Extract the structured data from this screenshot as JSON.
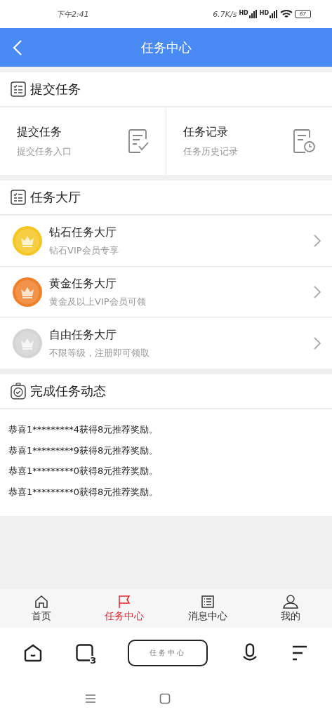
{
  "status_bar": {
    "time": "下午2:41",
    "speed": "6.7K/s",
    "signal_labels": [
      "HD",
      "HD"
    ],
    "battery": "67"
  },
  "header": {
    "title": "任务中心"
  },
  "submit_section": {
    "title": "提交任务",
    "cards": [
      {
        "kind": "submit",
        "title": "提交任务",
        "subtitle": "提交任务入口"
      },
      {
        "kind": "history",
        "title": "任务记录",
        "subtitle": "任务历史记录"
      }
    ]
  },
  "hall_section": {
    "title": "任务大厅",
    "items": [
      {
        "title": "钻石任务大厅",
        "subtitle": "钻石VIP会员专享",
        "color": "#f5c623"
      },
      {
        "title": "黄金任务大厅",
        "subtitle": "黄金及以上VIP会员可领",
        "color": "#f0802a"
      },
      {
        "title": "自由任务大厅",
        "subtitle": "不限等级，注册即可领取",
        "color": "#d4d4d4"
      }
    ]
  },
  "feed_section": {
    "title": "完成任务动态",
    "items": [
      "恭喜1*********4获得8元推荐奖励。",
      "恭喜1*********9获得8元推荐奖励。",
      "恭喜1*********0获得8元推荐奖励。",
      "恭喜1*********0获得8元推荐奖励。"
    ]
  },
  "tab_bar": [
    {
      "kind": "home",
      "label": "首页",
      "selected": false
    },
    {
      "kind": "flag",
      "label": "任务中心",
      "selected": true
    },
    {
      "kind": "list",
      "label": "消息中心",
      "selected": false
    },
    {
      "kind": "person",
      "label": "我的",
      "selected": false
    }
  ],
  "browser_bar": {
    "tab_count": "3",
    "address": "任务中心"
  }
}
